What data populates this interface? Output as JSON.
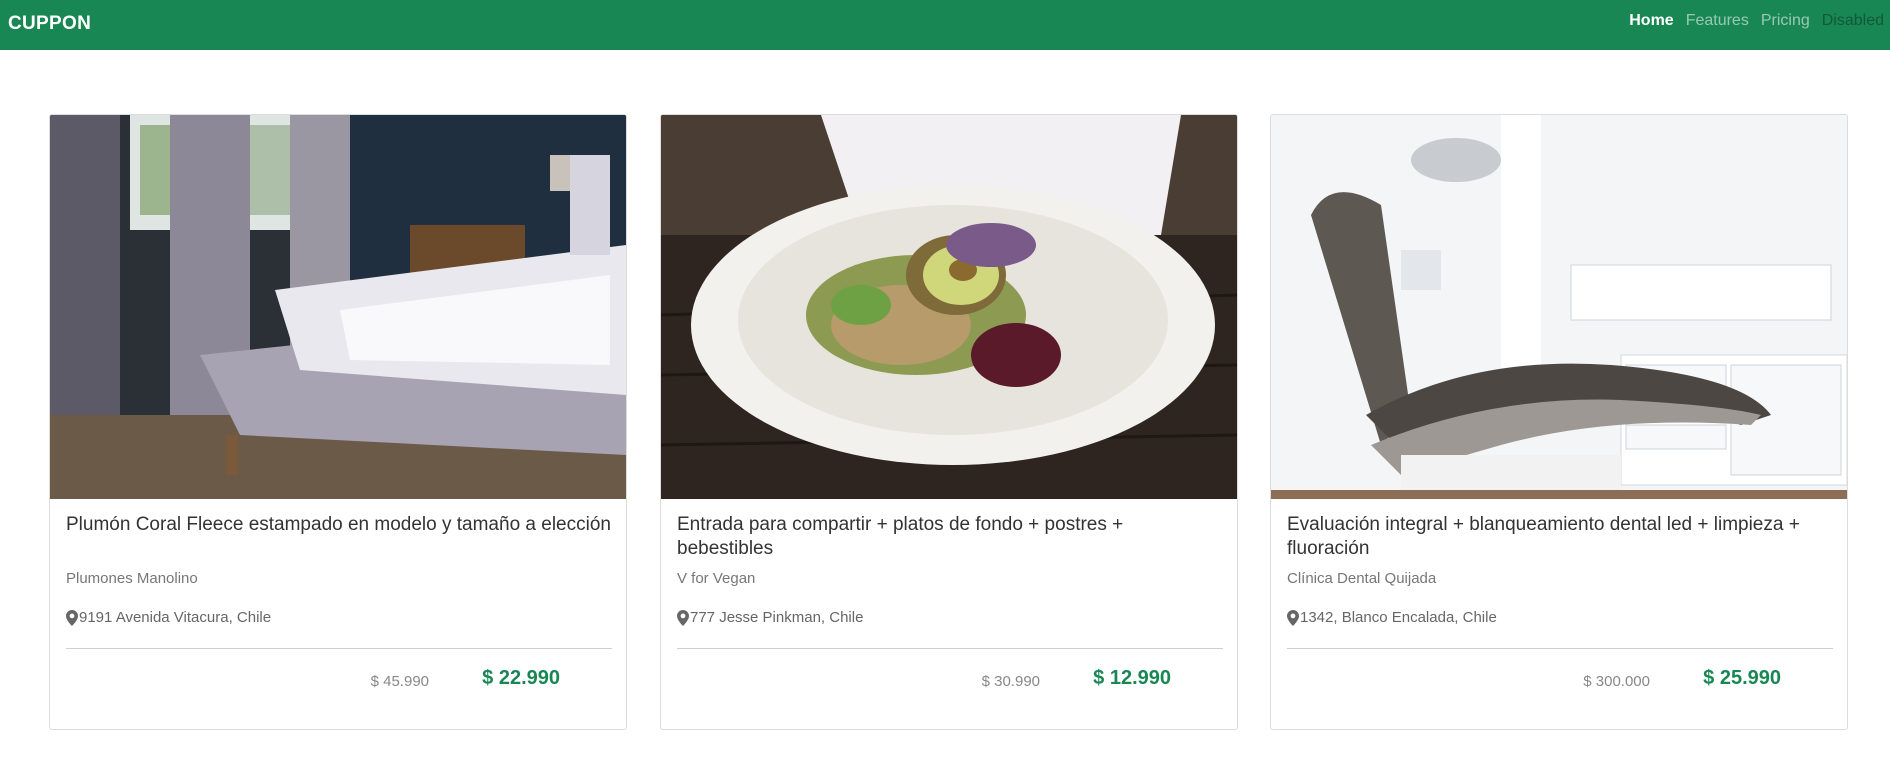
{
  "navbar": {
    "brand": "CUPPON",
    "links": [
      {
        "label": "Home"
      },
      {
        "label": "Features"
      },
      {
        "label": "Pricing"
      },
      {
        "label": "Disabled"
      }
    ]
  },
  "colors": {
    "brand_green": "#198754",
    "price_green": "#198754"
  },
  "cards": [
    {
      "title": "Plumón Coral Fleece estampado en modelo y tamaño a elección",
      "company": "Plumones Manolino",
      "location": "9191 Avenida Vitacura, Chile",
      "old_price": "$ 45.990",
      "new_price": "$ 22.990",
      "image": "bedroom-photo"
    },
    {
      "title": "Entrada para compartir + platos de fondo + postres + bebestibles",
      "company": "V for Vegan",
      "location": "777 Jesse Pinkman, Chile",
      "old_price": "$ 30.990",
      "new_price": "$ 12.990",
      "image": "vegan-dish-photo"
    },
    {
      "title": "Evaluación integral + blanqueamiento dental led + limpieza + fluoración",
      "company": "Clínica Dental Quijada",
      "location": "1342, Blanco Encalada, Chile",
      "old_price": "$ 300.000",
      "new_price": "$ 25.990",
      "image": "dental-clinic-photo"
    }
  ]
}
